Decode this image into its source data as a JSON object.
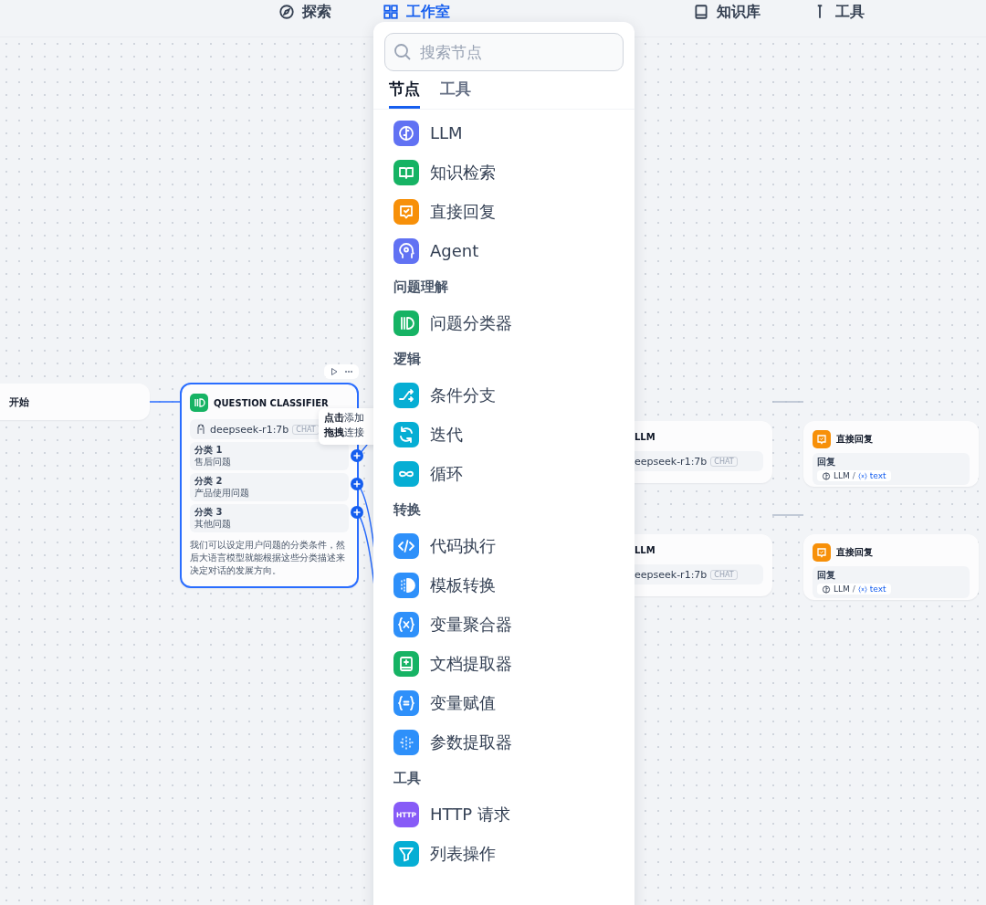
{
  "top_nav": [
    {
      "label": "探索",
      "kind": "explore",
      "selected": false
    },
    {
      "label": "工作室",
      "kind": "studio",
      "selected": true
    },
    {
      "label": "知识库",
      "kind": "knowledge",
      "selected": false
    },
    {
      "label": "工具",
      "kind": "tools",
      "selected": false
    }
  ],
  "canvas": {
    "start_node": {
      "title": "开始"
    },
    "classifier": {
      "title": "QUESTION CLASSIFIER",
      "model": "deepseek-r1:7b",
      "mode": "CHAT",
      "classes": [
        {
          "label": "分类 1",
          "text": "售后问题"
        },
        {
          "label": "分类 2",
          "text": "产品使用问题"
        },
        {
          "label": "分类 3",
          "text": "其他问题"
        }
      ],
      "description": "我们可以设定用户问题的分类条件，然后大语言模型就能根据这些分类描述来决定对话的发展方向。"
    },
    "tooltip": [
      "**点击**添加",
      "**拖拽**连接"
    ],
    "llm_nodes": [
      {
        "title": "LLM",
        "model": "eepseek-r1:7b",
        "mode": "CHAT"
      },
      {
        "title": "LLM",
        "model": "eepseek-r1:7b",
        "mode": "CHAT"
      }
    ],
    "reply_nodes": [
      {
        "title": "直接回复",
        "field_label": "回复",
        "source": "LLM",
        "separator": "/",
        "variable": "text"
      },
      {
        "title": "直接回复",
        "field_label": "回复",
        "source": "LLM",
        "separator": "/",
        "variable": "text"
      }
    ]
  },
  "node_menu": {
    "search": {
      "placeholder": "搜索节点"
    },
    "tabs": [
      {
        "label": "节点",
        "selected": true
      },
      {
        "label": "工具",
        "selected": false
      }
    ],
    "sections": [
      {
        "items": [
          {
            "label": "LLM",
            "kind": "llm",
            "color": "#6172f3"
          },
          {
            "label": "知识检索",
            "kind": "knowledge",
            "color": "#16b364"
          },
          {
            "label": "直接回复",
            "kind": "reply",
            "color": "#f79009"
          },
          {
            "label": "Agent",
            "kind": "agent",
            "color": "#6172f3"
          }
        ]
      },
      {
        "title": "问题理解",
        "items": [
          {
            "label": "问题分类器",
            "kind": "classifier",
            "color": "#16b364"
          }
        ]
      },
      {
        "title": "逻辑",
        "items": [
          {
            "label": "条件分支",
            "kind": "ifelse",
            "color": "#06aed4"
          },
          {
            "label": "迭代",
            "kind": "iteration",
            "color": "#06aed4"
          },
          {
            "label": "循环",
            "kind": "loop",
            "color": "#06aed4"
          }
        ]
      },
      {
        "title": "转换",
        "items": [
          {
            "label": "代码执行",
            "kind": "code",
            "color": "#2e90fa"
          },
          {
            "label": "模板转换",
            "kind": "template",
            "color": "#2e90fa"
          },
          {
            "label": "变量聚合器",
            "kind": "aggregator",
            "color": "#2e90fa"
          },
          {
            "label": "文档提取器",
            "kind": "doc",
            "color": "#16b364"
          },
          {
            "label": "变量赋值",
            "kind": "assign",
            "color": "#2e90fa"
          },
          {
            "label": "参数提取器",
            "kind": "param",
            "color": "#2e90fa"
          }
        ]
      },
      {
        "title": "工具",
        "items": [
          {
            "label": "HTTP 请求",
            "kind": "http",
            "color": "#875bf7",
            "icon_text": "HTTP"
          },
          {
            "label": "列表操作",
            "kind": "list",
            "color": "#06aed4"
          }
        ]
      }
    ]
  }
}
